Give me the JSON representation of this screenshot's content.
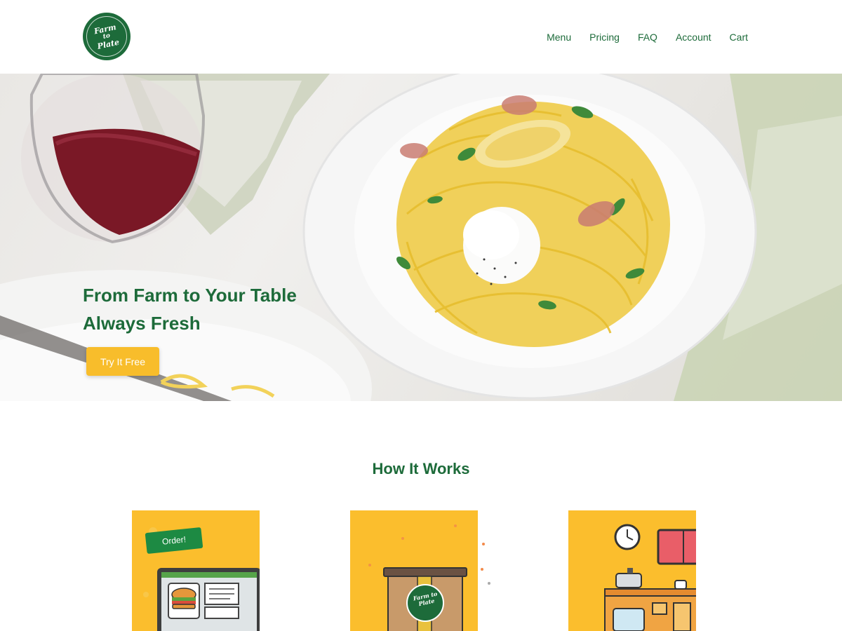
{
  "brand": {
    "logo_line1": "Farm",
    "logo_line2": "to",
    "logo_line3": "Plate",
    "color_primary": "#1d6b3a",
    "color_accent": "#f8bd2b"
  },
  "nav": {
    "items": [
      {
        "label": "Menu"
      },
      {
        "label": "Pricing"
      },
      {
        "label": "FAQ"
      },
      {
        "label": "Account"
      },
      {
        "label": "Cart"
      }
    ]
  },
  "hero": {
    "title_line1": "From Farm to Your Table",
    "title_line2": "Always Fresh",
    "cta_label": "Try It Free"
  },
  "how_it_works": {
    "title": "How It Works",
    "steps": [
      {
        "badge_text": "Order!",
        "illustration": "laptop-burger-icon"
      },
      {
        "badge_text": "Farm to Plate",
        "illustration": "delivery-box-icon"
      },
      {
        "badge_text": "",
        "illustration": "kitchen-icon"
      }
    ]
  }
}
